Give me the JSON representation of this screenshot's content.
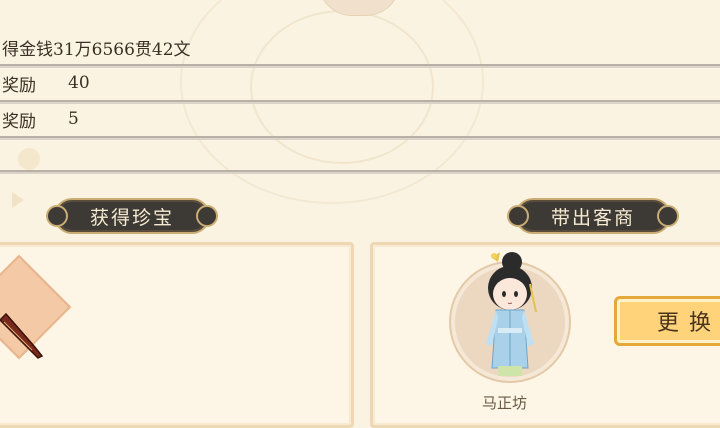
{
  "rewards": {
    "money_text": "得金钱31万6566贯42文",
    "row2": {
      "label": "奖励",
      "value": "40"
    },
    "row3": {
      "label": "奖励",
      "value": "5"
    }
  },
  "banners": {
    "treasure": "获得珍宝",
    "merchant": "带出客商"
  },
  "merchant": {
    "change_button": "更换",
    "name": "马正坊"
  },
  "colors": {
    "background": "#fbf3e2",
    "banner": "#3d3a36",
    "banner_border": "#c9ad74",
    "button": "#ffd37a"
  }
}
